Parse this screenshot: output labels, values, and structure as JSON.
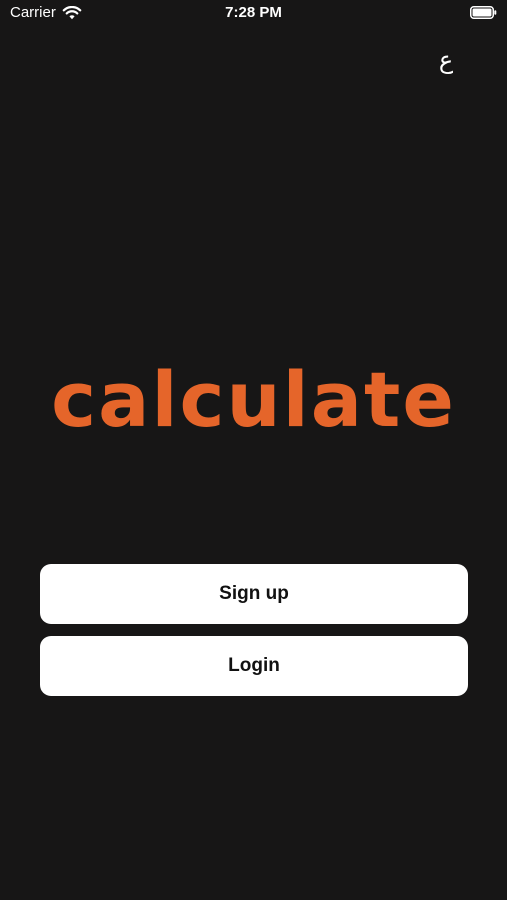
{
  "status_bar": {
    "carrier": "Carrier",
    "time": "7:28 PM",
    "wifi_icon": "wifi-icon",
    "battery_icon": "battery-icon"
  },
  "language_toggle": {
    "label": "ع"
  },
  "brand": {
    "logo_text": "calculate",
    "color": "#e5652a"
  },
  "actions": {
    "signup_label": "Sign up",
    "login_label": "Login"
  },
  "theme": {
    "background": "#171616",
    "button_background": "#ffffff",
    "button_text": "#111111"
  }
}
